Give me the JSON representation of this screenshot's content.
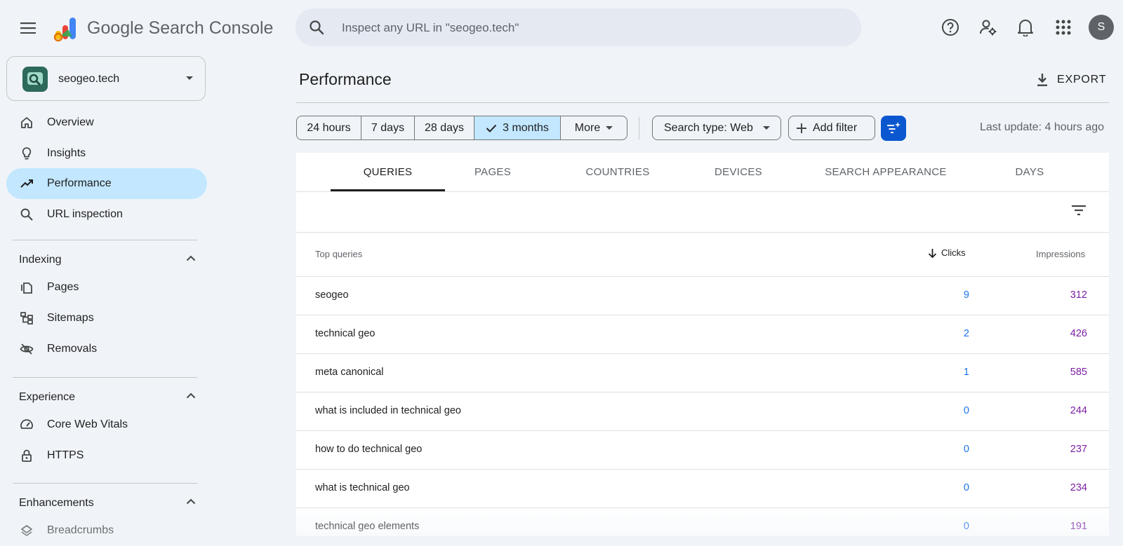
{
  "header": {
    "app_name": "Google Search Console",
    "search_placeholder": "Inspect any URL in \"seogeo.tech\"",
    "avatar_initial": "S"
  },
  "property": {
    "name": "seogeo.tech"
  },
  "sidebar": {
    "top_items": [
      {
        "label": "Overview",
        "icon": "home-icon"
      },
      {
        "label": "Insights",
        "icon": "lightbulb-icon"
      },
      {
        "label": "Performance",
        "icon": "trending-up-icon",
        "active": true
      },
      {
        "label": "URL inspection",
        "icon": "search-icon"
      }
    ],
    "sections": [
      {
        "title": "Indexing",
        "items": [
          {
            "label": "Pages",
            "icon": "pages-icon"
          },
          {
            "label": "Sitemaps",
            "icon": "sitemap-icon"
          },
          {
            "label": "Removals",
            "icon": "eye-off-icon"
          }
        ]
      },
      {
        "title": "Experience",
        "items": [
          {
            "label": "Core Web Vitals",
            "icon": "speedometer-icon"
          },
          {
            "label": "HTTPS",
            "icon": "lock-icon"
          }
        ]
      },
      {
        "title": "Enhancements",
        "items": [
          {
            "label": "Breadcrumbs",
            "icon": "layers-icon"
          }
        ]
      }
    ]
  },
  "main": {
    "page_title": "Performance",
    "export_label": "EXPORT",
    "date_ranges": [
      "24 hours",
      "7 days",
      "28 days",
      "3 months",
      "More"
    ],
    "selected_range": "3 months",
    "search_type_label": "Search type: Web",
    "add_filter_label": "Add filter",
    "last_update": "Last update: 4 hours ago",
    "tabs": [
      "QUERIES",
      "PAGES",
      "COUNTRIES",
      "DEVICES",
      "SEARCH APPEARANCE",
      "DAYS"
    ],
    "active_tab": "QUERIES",
    "table": {
      "columns": {
        "query": "Top queries",
        "clicks": "Clicks",
        "impressions": "Impressions"
      },
      "rows": [
        {
          "query": "seogeo",
          "clicks": "9",
          "impressions": "312"
        },
        {
          "query": "technical geo",
          "clicks": "2",
          "impressions": "426"
        },
        {
          "query": "meta canonical",
          "clicks": "1",
          "impressions": "585"
        },
        {
          "query": "what is included in technical geo",
          "clicks": "0",
          "impressions": "244"
        },
        {
          "query": "how to do technical geo",
          "clicks": "0",
          "impressions": "237"
        },
        {
          "query": "what is technical geo",
          "clicks": "0",
          "impressions": "234"
        },
        {
          "query": "technical geo elements",
          "clicks": "0",
          "impressions": "191"
        }
      ]
    }
  },
  "colors": {
    "accent": "#0b57d0",
    "active_bg": "#c2e7ff",
    "clicks": "#1a73e8",
    "impressions": "#7b1fa2"
  }
}
